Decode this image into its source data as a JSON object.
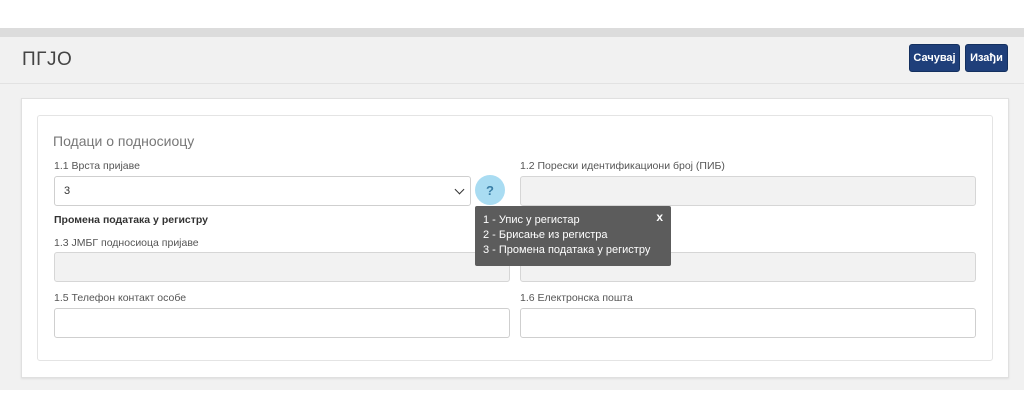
{
  "header": {
    "title": "ПГЈО",
    "save_label": "Сачувај",
    "exit_label": "Изађи"
  },
  "form": {
    "section_title": "Подаци о подносиоцу",
    "field_1_1": {
      "label": "1.1 Врста пријаве",
      "value": "3"
    },
    "field_1_2": {
      "label": "1.2 Порески идентификациони број (ПИБ)",
      "value": ""
    },
    "subheading": "Промена података у регистру",
    "field_1_3": {
      "label": "1.3 ЈМБГ подносиоца пријаве",
      "value": ""
    },
    "field_1_4": {
      "value": ""
    },
    "field_1_5": {
      "label": "1.5 Телефон контакт особе",
      "value": ""
    },
    "field_1_6": {
      "label": "1.6 Електронска пошта",
      "value": ""
    },
    "help_label": "?"
  },
  "tooltip": {
    "close_label": "x",
    "lines": [
      "1 - Упис у регистар",
      "2 - Брисање из регистра",
      "3 - Промена података у регистру"
    ]
  },
  "colors": {
    "button": "#1f3f7a",
    "help_bubble": "#a9dcf2",
    "tooltip_bg": "#5c5c5c"
  }
}
